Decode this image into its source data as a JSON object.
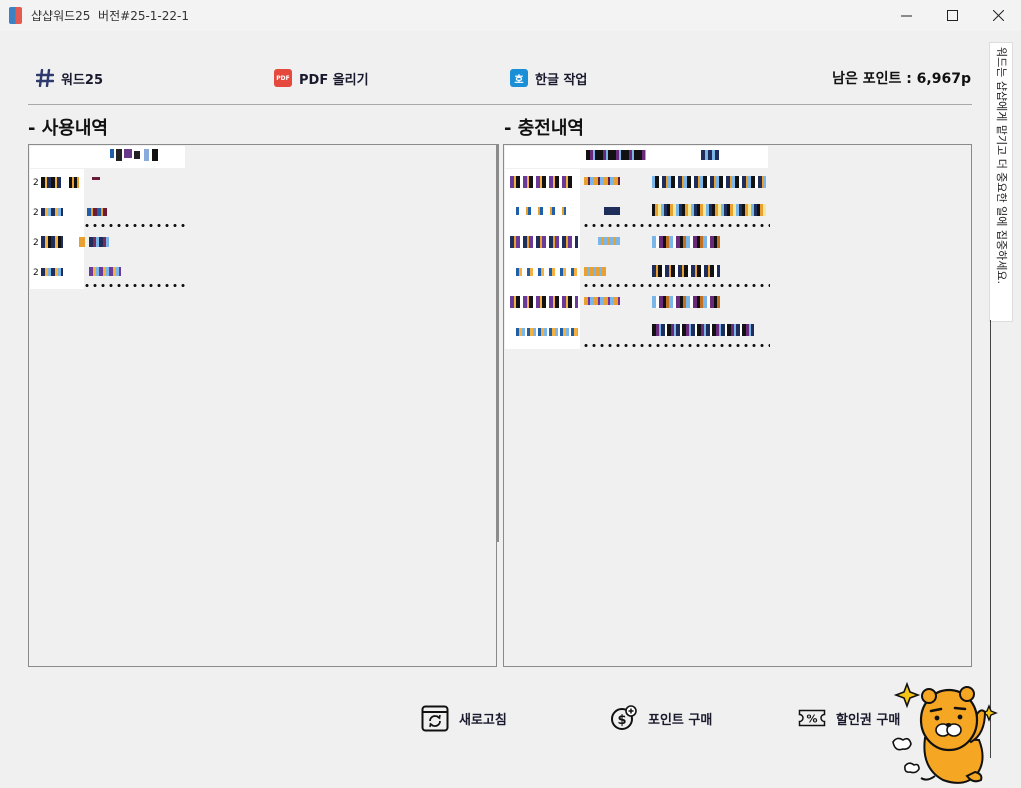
{
  "window": {
    "title": "샵샵워드25  버전#25-1-22-1",
    "controls": [
      "minimize-icon",
      "maximize-icon",
      "close-icon"
    ]
  },
  "toolbar": {
    "word25_label": "워드25",
    "pdf_label": "PDF 올리기",
    "pdf_icon_text": "PDF",
    "hangul_label": "한글 작업",
    "hangul_icon_text": "호"
  },
  "points": {
    "label": "남은 포인트 : 6,967p"
  },
  "sections": {
    "usage_title": "- 사용내역",
    "charge_title": "- 충전내역"
  },
  "usage_rows": {
    "row_prefix": "2"
  },
  "side_tab": {
    "text": "워드는 샵샵에게 맡기고 더 중요한 일에 집중하세요."
  },
  "bottom": {
    "refresh_label": "새로고침",
    "buy_points_label": "포인트 구매",
    "coupon_label": "할인권 구매"
  },
  "colors": {
    "accent": "#1a1a2e",
    "pdf_red": "#e5483c",
    "hangul_blue": "#1a8fd8",
    "mascot_orange": "#f5a623"
  }
}
